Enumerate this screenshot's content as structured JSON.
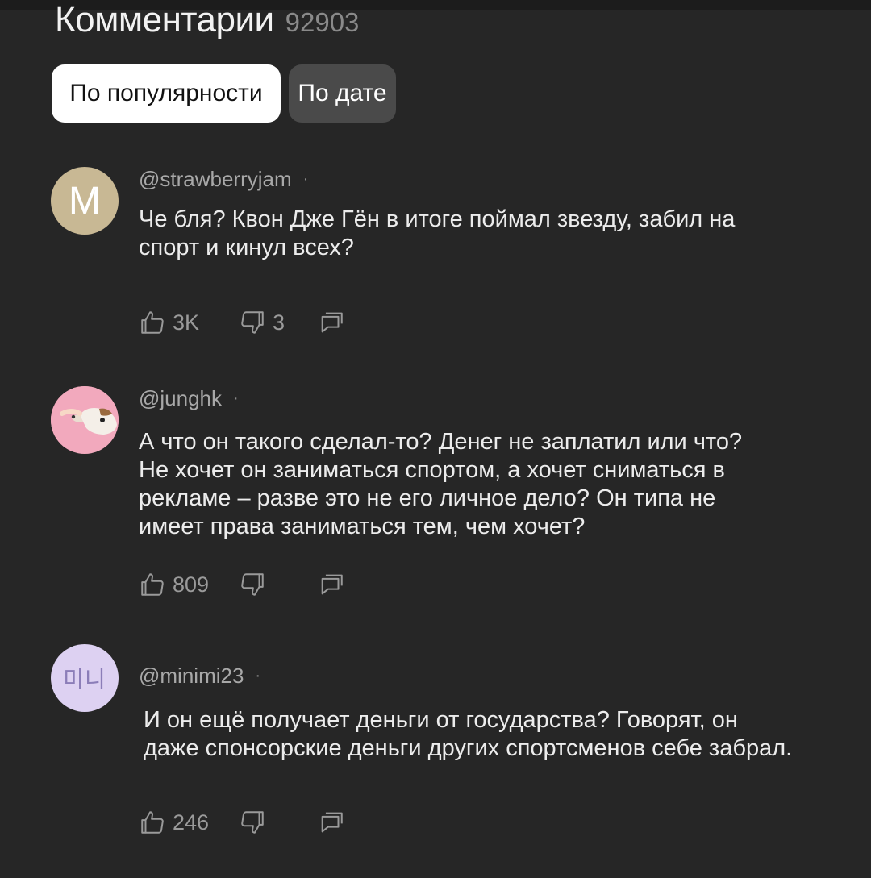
{
  "header": {
    "title": "Комментарии",
    "count": "92903"
  },
  "sort_chips": {
    "popular_label": "По популярности",
    "date_label": "По дате"
  },
  "colors": {
    "background": "#262626",
    "chip_active_bg": "#ffffff",
    "chip_inactive_bg": "#4a4a4a",
    "secondary_text": "#a8a8a8"
  },
  "comments": [
    {
      "avatar_letter": "M",
      "author": "@strawberryjam",
      "separator": "·",
      "text": "Че бля? Квон Дже Гён в итоге поймал звезду, забил на\nспорт и кинул всех?",
      "likes": "3K",
      "dislikes": "3",
      "icons": [
        "thumb-up-icon",
        "thumb-down-icon",
        "reply-icon"
      ]
    },
    {
      "avatar_letter": "",
      "author": "@junghk",
      "separator": "·",
      "text": "А что он такого сделал-то? Денег не заплатил или что?\nНе хочет он заниматься спортом, а хочет сниматься в\nрекламе – разве это не его личное дело? Он типа не\nимеет права заниматься тем, чем хочет?",
      "likes": "809",
      "dislikes": "",
      "icons": [
        "thumb-up-icon",
        "thumb-down-icon",
        "reply-icon"
      ]
    },
    {
      "avatar_letter": "미니",
      "author": "@minimi23",
      "separator": "·",
      "text": "И он ещё получает деньги от государства? Говорят, он\nдаже спонсорские деньги других спортсменов себе забрал.",
      "likes": "246",
      "dislikes": "",
      "icons": [
        "thumb-up-icon",
        "thumb-down-icon",
        "reply-icon"
      ]
    }
  ]
}
